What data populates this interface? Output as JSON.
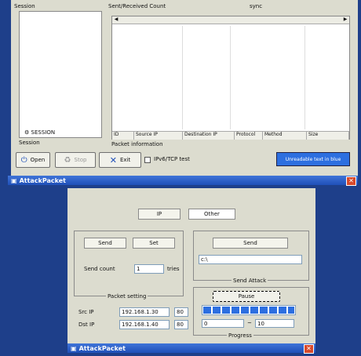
{
  "top_window": {
    "sessions_group_label": "Session",
    "session_list_header": "SESSION",
    "tree_header_label": "Session",
    "packet_group_label": "Packet information",
    "packet_header_label": "Sent/Received Count",
    "columns": [
      "ID",
      "Source IP",
      "Destination IP",
      "Protocol",
      "Method",
      "Size"
    ],
    "open_button": "Open",
    "stop_button": "Stop",
    "exit_button": "Exit",
    "ipv6_checkbox_label": "IPv6/TCP test",
    "blue_button": "Unreadable text in blue",
    "sync_label": "sync",
    "title": "AttackPacket"
  },
  "bottom_window": {
    "title": "AttackPacket",
    "tab_ip": "IP",
    "tab_other": "Other",
    "send_group": "Packet setting",
    "send_tab_1": "Send",
    "send_tab_2": "Set",
    "count_label": "Send count",
    "count_value": "1",
    "count_unit": "tries",
    "addr_label_1": "Src IP",
    "addr_value_1": "192.168.1.30",
    "addr_port_1": "80",
    "addr_label_2": "Dst IP",
    "addr_value_2": "192.168.1.40",
    "addr_port_2": "80",
    "file_group": "Send Attack",
    "file_button": "Send",
    "file_input": "c:\\",
    "progress_group": "Progress",
    "progress_button": "Pause",
    "progress_from": "0",
    "progress_to": "10",
    "progress_dash": "~",
    "progress_fraction": 1.0
  },
  "colors": {
    "desktop": "#1e3f8a",
    "accent_blue": "#2d6fe0",
    "close_red": "#d8492b"
  }
}
